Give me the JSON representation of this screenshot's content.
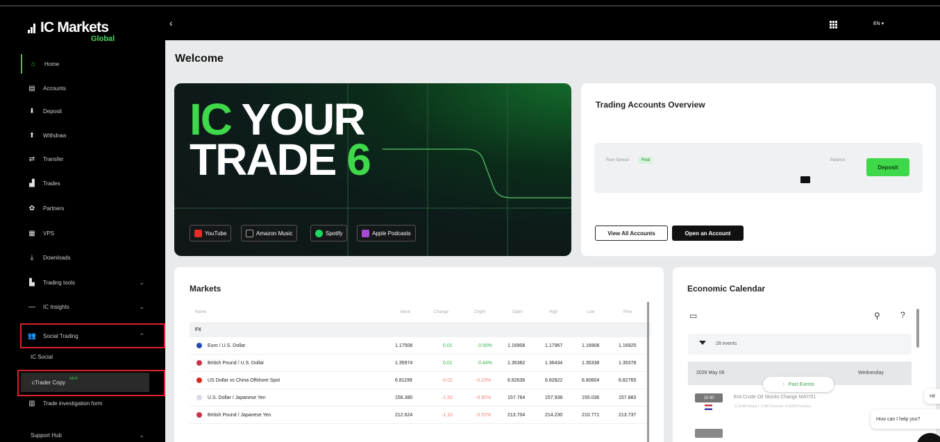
{
  "brand": {
    "name": "IC Markets",
    "sub": "Global"
  },
  "sidebar": {
    "items": [
      {
        "label": "Home",
        "icon": "home-icon"
      },
      {
        "label": "Accounts",
        "icon": "accounts-icon"
      },
      {
        "label": "Deposit",
        "icon": "deposit-icon"
      },
      {
        "label": "Withdraw",
        "icon": "withdraw-icon"
      },
      {
        "label": "Transfer",
        "icon": "transfer-icon"
      },
      {
        "label": "Trades",
        "icon": "trades-icon"
      },
      {
        "label": "Partners",
        "icon": "partners-icon"
      },
      {
        "label": "VPS",
        "icon": "vps-icon"
      },
      {
        "label": "Downloads",
        "icon": "downloads-icon"
      },
      {
        "label": "Trading tools",
        "icon": "trading-tools-icon"
      },
      {
        "label": "IC Insights",
        "icon": "insights-icon"
      },
      {
        "label": "Social Trading",
        "icon": "social-trading-icon"
      }
    ],
    "sub_items": [
      "IC Social"
    ],
    "copy_item": {
      "label": "cTrader Copy",
      "badge": "NEW"
    },
    "form_item": "Trade investigation form",
    "support": "Support Hub"
  },
  "topbar": {
    "back": "‹",
    "lang": "EN ▾"
  },
  "page": {
    "title": "Welcome"
  },
  "banner": {
    "line1_accent": "IC",
    "line1_rest": " YOUR",
    "line2_rest": "TRADE ",
    "line2_accent": "6",
    "podcasts": [
      "YouTube",
      "Amazon Music",
      "Spotify",
      "Apple Podcasts"
    ]
  },
  "accounts_overview": {
    "title": "Trading Accounts Overview",
    "account_type": "Raw Spread",
    "account_tag": "Real",
    "balance_label": "Balance",
    "deposit": "Deposit",
    "view_all": "View All Accounts",
    "open_account": "Open an Account"
  },
  "markets": {
    "title": "Markets",
    "columns": [
      "Name",
      "Value",
      "Change",
      "Chg%",
      "Open",
      "High",
      "Low",
      "Prev"
    ],
    "group": "FX",
    "rows": [
      {
        "name": "Euro / U.S. Dollar",
        "value": "1.17508",
        "change": "0.01",
        "chg": "0.50%",
        "open": "1.16908",
        "high": "1.17967",
        "low": "1.16908",
        "prev": "1.16925",
        "dir": "pos"
      },
      {
        "name": "British Pound / U.S. Dollar",
        "value": "1.35974",
        "change": "0.01",
        "chg": "0.44%",
        "open": "1.35382",
        "high": "1.36434",
        "low": "1.35338",
        "prev": "1.35378",
        "dir": "pos"
      },
      {
        "name": "US Dollar vs China Offshore Spot",
        "value": "6.81199",
        "change": "-0.02",
        "chg": "-0.23%",
        "open": "6.82636",
        "high": "6.82822",
        "low": "6.80604",
        "prev": "6.82765",
        "dir": "neg"
      },
      {
        "name": "U.S. Dollar / Japanese Yen",
        "value": "156.380",
        "change": "-1.50",
        "chg": "-0.95%",
        "open": "157.764",
        "high": "157.938",
        "low": "155.036",
        "prev": "157.883",
        "dir": "neg"
      },
      {
        "name": "British Pound / Japanese Yen",
        "value": "212.624",
        "change": "-1.10",
        "chg": "-0.52%",
        "open": "213.704",
        "high": "214.230",
        "low": "210.771",
        "prev": "213.737",
        "dir": "neg"
      }
    ]
  },
  "calendar": {
    "title": "Economic Calendar",
    "events_count": "28 events",
    "date": "2026 May 06",
    "weekday": "Wednesday",
    "past_events": "Past Events",
    "event": {
      "time": "15:30",
      "title": "EIA Crude Oil Stocks Change MAY/01",
      "sub": "-3.314M Actual | -3.3M Forecast -4.226M Previous"
    }
  },
  "chat": {
    "hi": "Hi!",
    "help": "How can I help you?"
  },
  "colors": {
    "accent": "#3fd84a",
    "highlight_box": "#e0202a"
  }
}
